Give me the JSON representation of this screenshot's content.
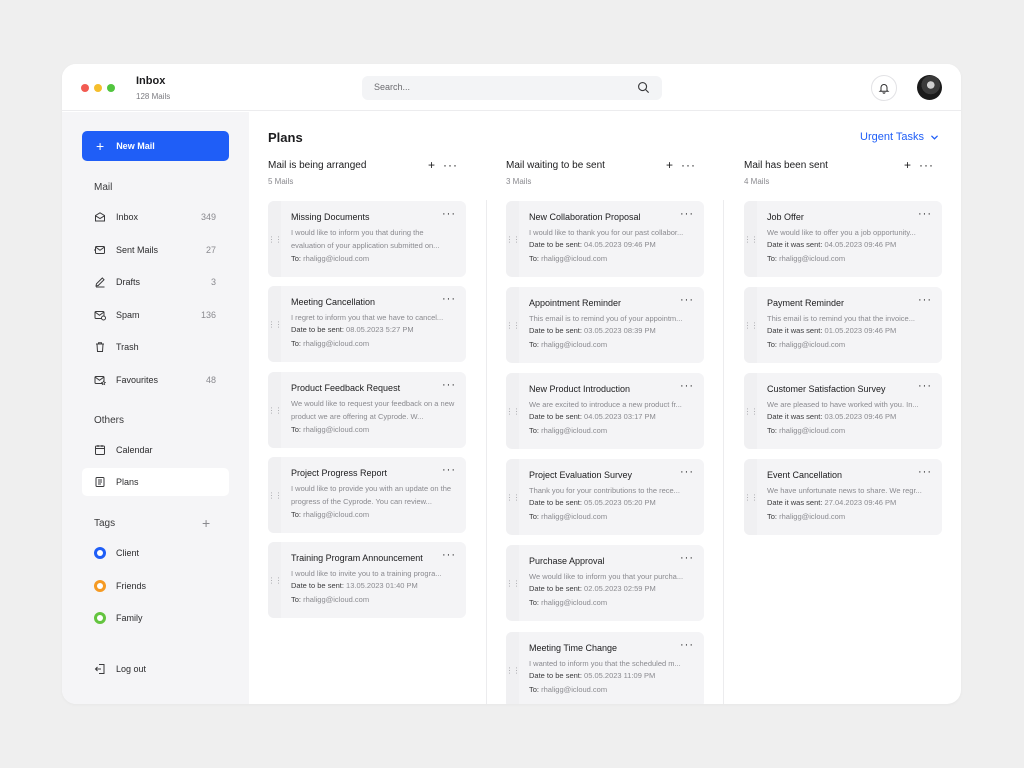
{
  "header": {
    "title": "Inbox",
    "subtitle": "128 Mails",
    "search_placeholder": "Search...",
    "window_dot_colors": [
      "#f25b52",
      "#f5be2c",
      "#52c53f"
    ]
  },
  "sidebar": {
    "new_mail_label": "New Mail",
    "mail_section": "Mail",
    "mail_items": [
      {
        "label": "Inbox",
        "count": "349",
        "icon": "inbox-icon"
      },
      {
        "label": "Sent Mails",
        "count": "27",
        "icon": "send-icon"
      },
      {
        "label": "Drafts",
        "count": "3",
        "icon": "pencil-icon"
      },
      {
        "label": "Spam",
        "count": "136",
        "icon": "spam-icon"
      },
      {
        "label": "Trash",
        "count": "",
        "icon": "trash-icon"
      },
      {
        "label": "Favourites",
        "count": "48",
        "icon": "favourite-icon"
      }
    ],
    "others_section": "Others",
    "other_items": [
      {
        "label": "Calendar",
        "icon": "calendar-icon"
      },
      {
        "label": "Plans",
        "icon": "document-icon",
        "active": true
      }
    ],
    "tags_section": "Tags",
    "tags": [
      {
        "label": "Client",
        "color": "#1f5ef7"
      },
      {
        "label": "Friends",
        "color": "#f59a23"
      },
      {
        "label": "Family",
        "color": "#64c43f"
      }
    ],
    "logout_label": "Log out"
  },
  "main": {
    "title": "Plans",
    "urgent_label": "Urgent Tasks",
    "accent": "#1f5ef7",
    "columns": [
      {
        "title": "Mail is being arranged",
        "count": "5 Mails",
        "cards": [
          {
            "title": "Missing Documents",
            "body": "I would like to inform you that during the evaluation of your application submitted on...",
            "to_label": "To:",
            "to": "rhaligg@icloud.com"
          },
          {
            "title": "Meeting Cancellation",
            "body": "I regret to inform you that we have to cancel...",
            "date_label": "Date to be sent:",
            "date": "08.05.2023 5:27 PM",
            "to_label": "To:",
            "to": "rhaligg@icloud.com"
          },
          {
            "title": "Product Feedback Request",
            "body": "We would like to request your feedback on a new product we are offering at Cyprode. W...",
            "to_label": "To:",
            "to": "rhaligg@icloud.com"
          },
          {
            "title": "Project Progress Report",
            "body": "I would like to provide you with an update on the progress of the Cyprode. You can review...",
            "to_label": "To:",
            "to": "rhaligg@icloud.com"
          },
          {
            "title": "Training Program Announcement",
            "body": "I would like to invite you to a training progra...",
            "date_label": "Date to be sent:",
            "date": "13.05.2023 01:40 PM",
            "to_label": "To:",
            "to": "rhaligg@icloud.com"
          }
        ]
      },
      {
        "title": "Mail waiting to be sent",
        "count": "3 Mails",
        "cards": [
          {
            "title": "New Collaboration Proposal",
            "body": "I would like to thank you for our past collabor...",
            "date_label": "Date to be sent:",
            "date": "04.05.2023 09:46 PM",
            "to_label": "To:",
            "to": "rhaligg@icloud.com"
          },
          {
            "title": "Appointment Reminder",
            "body": "This email is to remind you of your appointm...",
            "date_label": "Date to be sent:",
            "date": "03.05.2023 08:39 PM",
            "to_label": "To:",
            "to": "rhaligg@icloud.com"
          },
          {
            "title": "New Product Introduction",
            "body": "We are excited to introduce a new product fr...",
            "date_label": "Date to be sent:",
            "date": "04.05.2023 03:17 PM",
            "to_label": "To:",
            "to": "rhaligg@icloud.com"
          },
          {
            "title": "Project Evaluation Survey",
            "body": "Thank you for your contributions to the rece...",
            "date_label": "Date to be sent:",
            "date": "05.05.2023 05:20 PM",
            "to_label": "To:",
            "to": "rhaligg@icloud.com"
          },
          {
            "title": "Purchase Approval",
            "body": "We would like to inform you that your purcha...",
            "date_label": "Date to be sent:",
            "date": "02.05.2023 02:59 PM",
            "to_label": "To:",
            "to": "rhaligg@icloud.com"
          },
          {
            "title": "Meeting Time Change",
            "body": "I wanted to inform you that the scheduled m...",
            "date_label": "Date to be sent:",
            "date": "05.05.2023 11:09 PM",
            "to_label": "To:",
            "to": "rhaligg@icloud.com"
          }
        ]
      },
      {
        "title": "Mail has been sent",
        "count": "4 Mails",
        "cards": [
          {
            "title": "Job Offer",
            "body": "We would like to offer you a job opportunity...",
            "date_label": "Date it was sent:",
            "date": "04.05.2023 09:46 PM",
            "to_label": "To:",
            "to": "rhaligg@icloud.com"
          },
          {
            "title": "Payment Reminder",
            "body": "This email is to remind you that the invoice...",
            "date_label": "Date it was sent:",
            "date": "01.05.2023 09:46 PM",
            "to_label": "To:",
            "to": "rhaligg@icloud.com"
          },
          {
            "title": "Customer Satisfaction Survey",
            "body": "We are pleased to have worked with you. In...",
            "date_label": "Date it was sent:",
            "date": "03.05.2023 09:46 PM",
            "to_label": "To:",
            "to": "rhaligg@icloud.com"
          },
          {
            "title": "Event Cancellation",
            "body": "We have unfortunate news to share. We regr...",
            "date_label": "Date it was sent:",
            "date": "27.04.2023 09:46 PM",
            "to_label": "To:",
            "to": "rhaligg@icloud.com"
          }
        ]
      }
    ]
  }
}
